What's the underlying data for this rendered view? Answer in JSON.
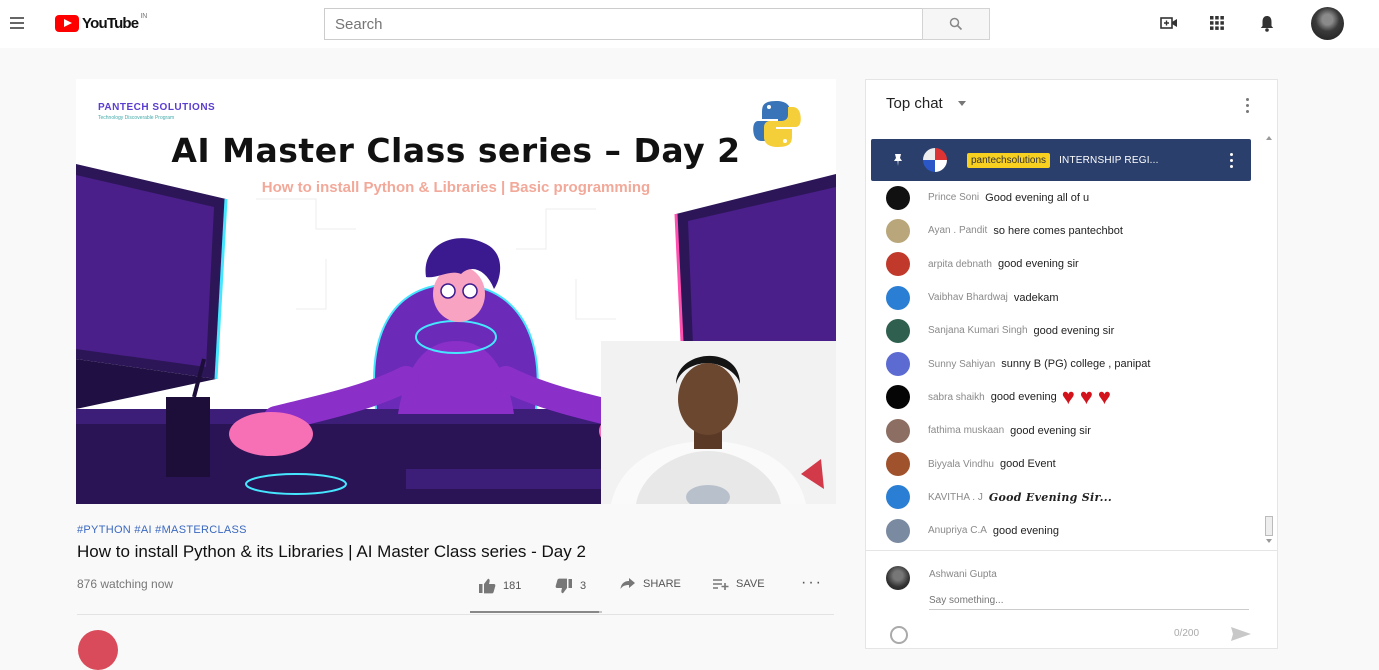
{
  "masthead": {
    "logo_text": "YouTube",
    "logo_region": "IN",
    "search_placeholder": "Search",
    "icons": [
      "menu-icon",
      "search-icon",
      "create-video-icon",
      "apps-grid-icon",
      "notifications-bell-icon",
      "account-avatar"
    ]
  },
  "player": {
    "brand": "PANTECH SOLUTIONS",
    "brand_tagline": "Technology Discoverable Program",
    "title": "AI Master Class series – Day 2",
    "subtitle": "How to install Python & Libraries | Basic programming"
  },
  "video": {
    "hashtags": "#PYTHON #AI #MASTERCLASS",
    "title": "How to install Python & its Libraries | AI Master Class series - Day 2",
    "views": "876 watching now",
    "likes": "181",
    "dislikes": "3",
    "share_label": "SHARE",
    "save_label": "SAVE",
    "like_ratio": 0.98
  },
  "chat": {
    "header_title": "Top chat",
    "pinned": {
      "author": "pantechsolutions",
      "message": "INTERNSHIP REGI..."
    },
    "messages": [
      {
        "author": "Prince Soni",
        "text": "Good evening all of u",
        "avatar": "#111111"
      },
      {
        "author": "Ayan . Pandit",
        "text": "so here comes pantechbot",
        "avatar": "#b9a67a"
      },
      {
        "author": "arpita debnath",
        "text": "good evening sir",
        "avatar": "#c0392b"
      },
      {
        "author": "Vaibhav Bhardwaj",
        "text": "vadekam",
        "avatar": "#2a7fd4"
      },
      {
        "author": "Sanjana Kumari Singh",
        "text": "good evening sir",
        "avatar": "#2f5f4f"
      },
      {
        "author": "Sunny Sahiyan",
        "text": "sunny B (PG) college , panipat",
        "avatar": "#5b6bd1"
      },
      {
        "author": "sabra shaikh",
        "text": "good evening",
        "avatar": "#050505"
      },
      {
        "author": "fathima muskaan",
        "text": "good evening sir",
        "avatar": "#8d6e63"
      },
      {
        "author": "Biyyala Vindhu",
        "text": "good Event",
        "avatar": "#a0522d"
      },
      {
        "author": "KAVITHA . J",
        "text": "Good Evening Sir...",
        "avatar": "#2a7fd4"
      },
      {
        "author": "Anupriya C.A",
        "text": "good evening",
        "avatar": "#7a8aa0"
      }
    ],
    "composer": {
      "name": "Ashwani Gupta",
      "placeholder": "Say something...",
      "counter": "0/200"
    }
  }
}
